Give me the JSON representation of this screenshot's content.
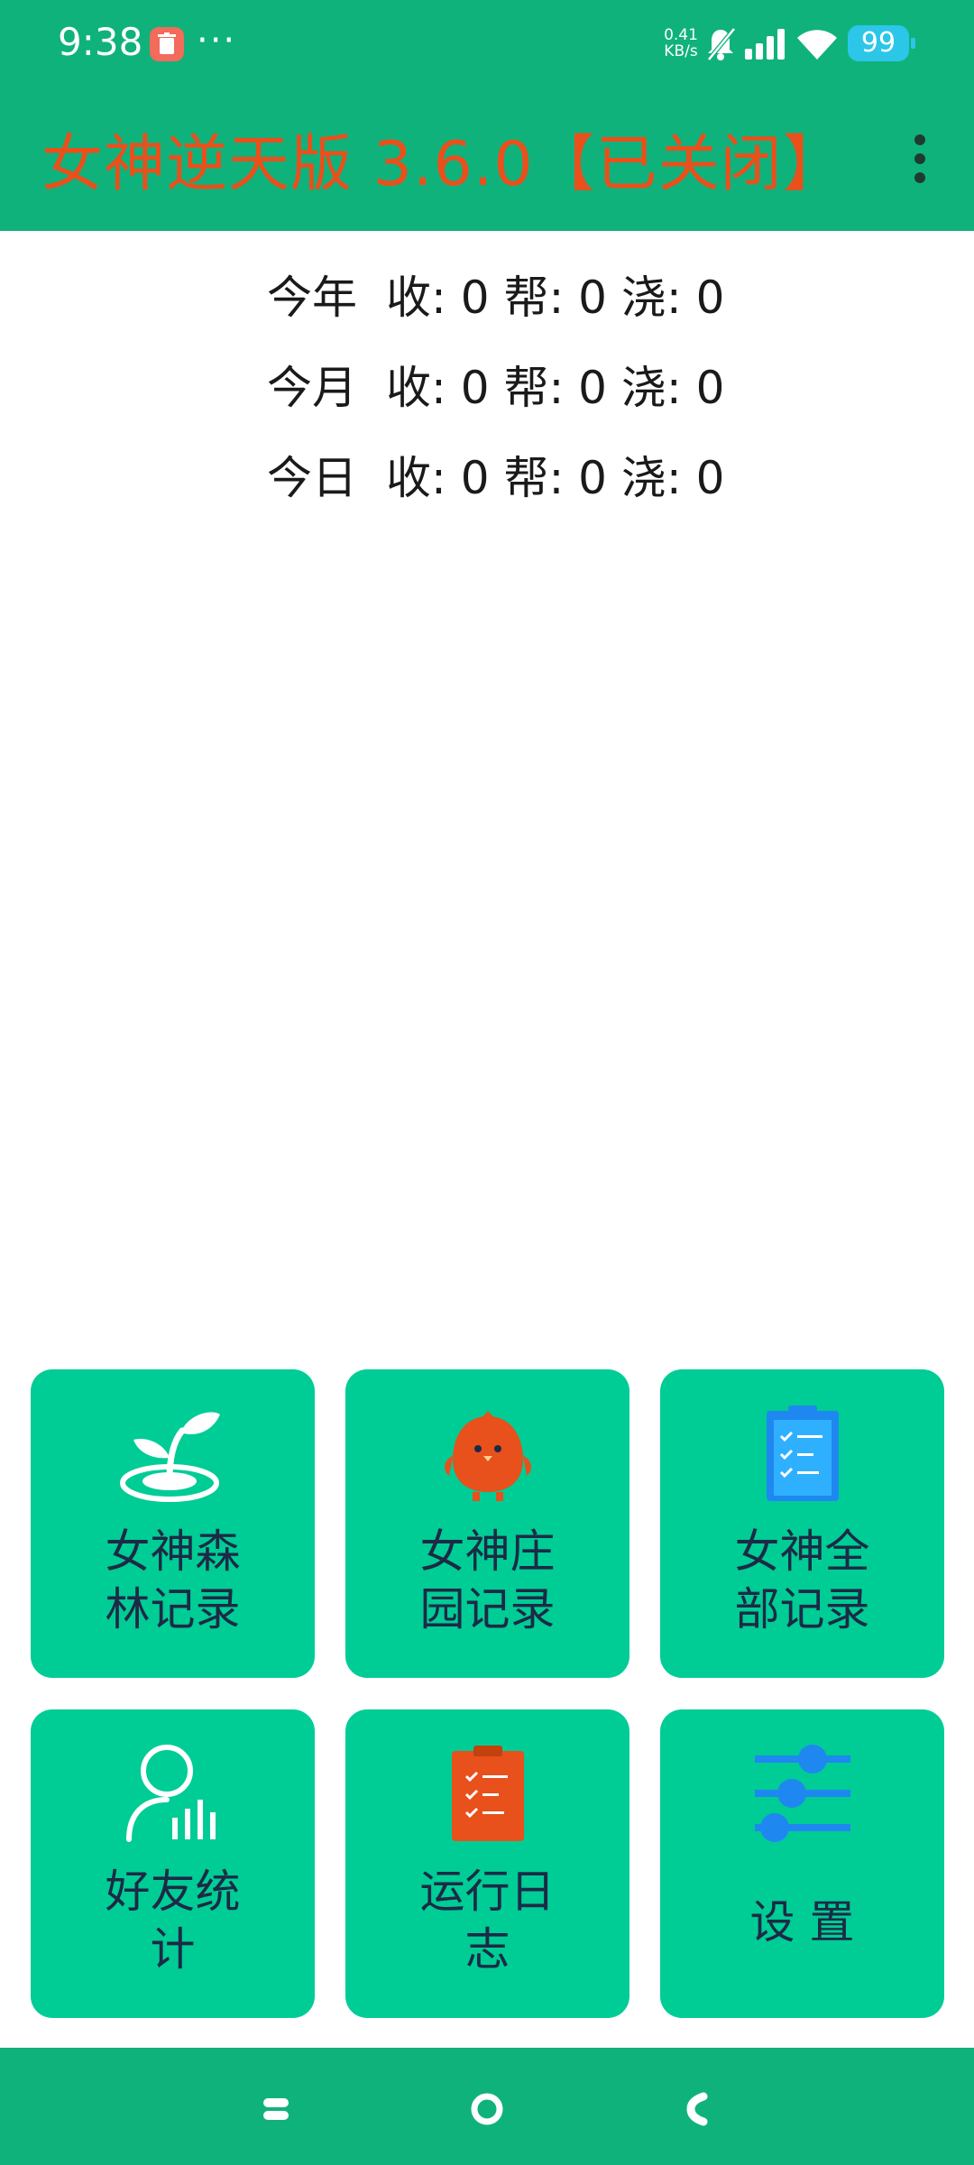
{
  "status_bar": {
    "time": "9:38",
    "net_speed_value": "0.41",
    "net_speed_unit": "KB/s",
    "battery": "99",
    "icons": [
      "app-notification-icon",
      "more-dots",
      "bell-muted-icon",
      "signal-icon",
      "wifi-icon",
      "battery-icon"
    ]
  },
  "app_bar": {
    "title": "女神逆天版 3.6.0【已关闭】",
    "menu_icon": "overflow-menu-icon",
    "title_color": "#e8501c",
    "bar_color": "#10b27c"
  },
  "stats": [
    {
      "period": "今年",
      "text": "收: 0 帮: 0 浇: 0"
    },
    {
      "period": "今月",
      "text": "收: 0 帮: 0 浇: 0"
    },
    {
      "period": "今日",
      "text": "收: 0 帮: 0 浇: 0"
    }
  ],
  "tiles": [
    {
      "line1": "女神森",
      "line2": "林记录",
      "icon": "sprout-icon"
    },
    {
      "line1": "女神庄",
      "line2": "园记录",
      "icon": "chick-icon"
    },
    {
      "line1": "女神全",
      "line2": "部记录",
      "icon": "clipboard-blue-icon"
    },
    {
      "line1": "好友统",
      "line2": "计",
      "icon": "friend-stats-icon"
    },
    {
      "line1": "运行日",
      "line2": "志",
      "icon": "clipboard-orange-icon"
    },
    {
      "line1": "设 置",
      "line2": "",
      "icon": "sliders-icon"
    }
  ],
  "colors": {
    "tile_bg": "#00cc96",
    "tile_text": "#1d2a45",
    "orange_icon": "#e8501c",
    "blue_icon": "#1e88f0"
  },
  "nav_bar": {
    "icons": [
      "recent-apps-icon",
      "home-icon",
      "back-icon"
    ]
  }
}
